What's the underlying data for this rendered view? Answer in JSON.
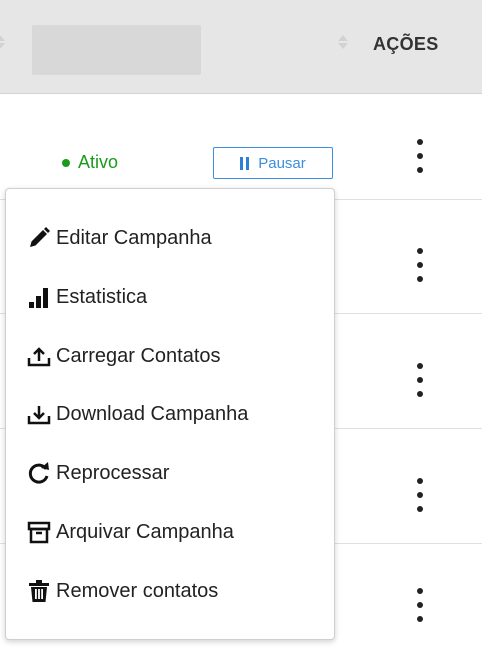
{
  "header": {
    "actions_label": "AÇÕES"
  },
  "row": {
    "status_label": "Ativo",
    "pause_label": "Pausar"
  },
  "menu": {
    "items": [
      {
        "label": "Editar Campanha",
        "icon": "pencil-icon"
      },
      {
        "label": "Estatistica",
        "icon": "bar-chart-icon"
      },
      {
        "label": "Carregar Contatos",
        "icon": "upload-icon"
      },
      {
        "label": "Download Campanha",
        "icon": "download-icon"
      },
      {
        "label": "Reprocessar",
        "icon": "refresh-icon"
      },
      {
        "label": "Arquivar Campanha",
        "icon": "archive-icon"
      },
      {
        "label": "Remover contatos",
        "icon": "trash-icon"
      }
    ]
  },
  "colors": {
    "status_active": "#1a9b1a",
    "accent": "#3b8ee0",
    "header_bg": "#e6e6e6"
  }
}
